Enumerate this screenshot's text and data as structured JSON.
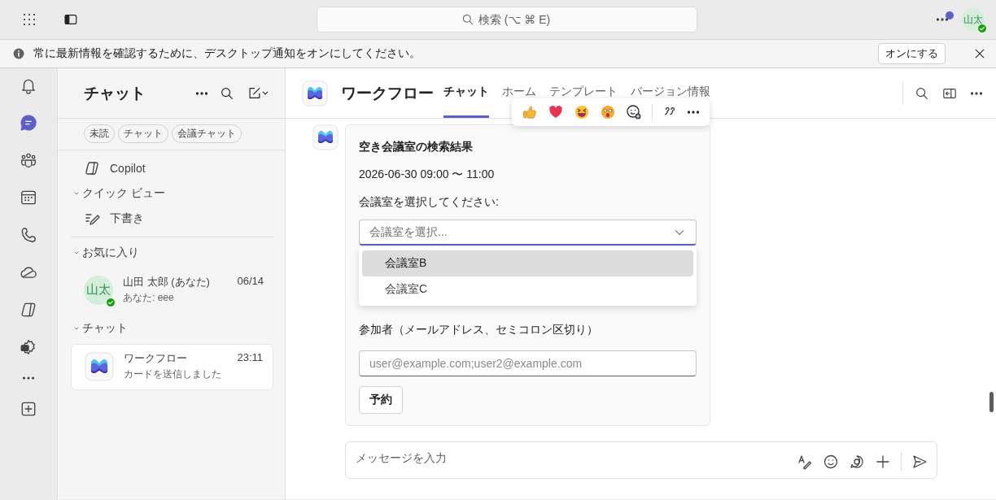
{
  "top_bar": {
    "search": {
      "placeholder": "検索 (⌥ ⌘ E)"
    },
    "avatar": {
      "initials": "山太"
    }
  },
  "notification": {
    "text": "常に最新情報を確認するために、デスクトップ通知をオンにしてください。",
    "button": "オンにする"
  },
  "rail": [
    {
      "kind": "bell",
      "selected": false
    },
    {
      "kind": "chat",
      "selected": true
    },
    {
      "kind": "people",
      "selected": false
    },
    {
      "kind": "calendar",
      "selected": false
    },
    {
      "kind": "phone",
      "selected": false
    },
    {
      "kind": "cloud",
      "selected": false
    },
    {
      "kind": "copilot",
      "selected": false
    },
    {
      "kind": "gear",
      "selected": false
    },
    {
      "kind": "more",
      "selected": false
    },
    {
      "kind": "add",
      "selected": false
    }
  ],
  "chat_list": {
    "title": "チャット",
    "filters": [
      "未読",
      "チャット",
      "会議チャット"
    ],
    "items": [
      {
        "kind": "copilot",
        "label": "Copilot"
      }
    ],
    "sections": [
      {
        "title": "クイック ビュー",
        "expanded": true,
        "items": [
          {
            "kind": "drafts",
            "label": "下書き"
          }
        ]
      },
      {
        "title": "お気に入り",
        "expanded": true,
        "items": [
          {
            "kind": "person",
            "initials": "山太",
            "name": "山田 太郎 (あなた)",
            "preview": "あなた: eee",
            "time": "06/14",
            "selected": false
          }
        ]
      },
      {
        "title": "チャット",
        "expanded": true,
        "items": [
          {
            "kind": "bot",
            "name": "ワークフロー",
            "preview": "カードを送信しました",
            "time": "23:11",
            "selected": true
          }
        ]
      }
    ]
  },
  "conversation": {
    "title": "ワークフロー",
    "tabs": [
      {
        "label": "チャット",
        "selected": true
      },
      {
        "label": "ホーム",
        "selected": false
      },
      {
        "label": "テンプレート",
        "selected": false
      },
      {
        "label": "バージョン情報",
        "selected": false
      }
    ],
    "card": {
      "title": "空き会議室の検索結果",
      "datetime": "2026-06-30 09:00 〜 11:00",
      "room_label": "会議室を選択してください:",
      "room_select": {
        "placeholder": "会議室を選択...",
        "expanded": true,
        "options": [
          {
            "label": "会議室B",
            "selected": true
          },
          {
            "label": "会議室C",
            "selected": false
          }
        ]
      },
      "participants_label": "参加者（メールアドレス、セミコロン区切り）",
      "participants_field": {
        "placeholder": "user@example.com;user2@example.com"
      },
      "button": "予約"
    },
    "composer": {
      "placeholder": "メッセージを入力"
    }
  }
}
